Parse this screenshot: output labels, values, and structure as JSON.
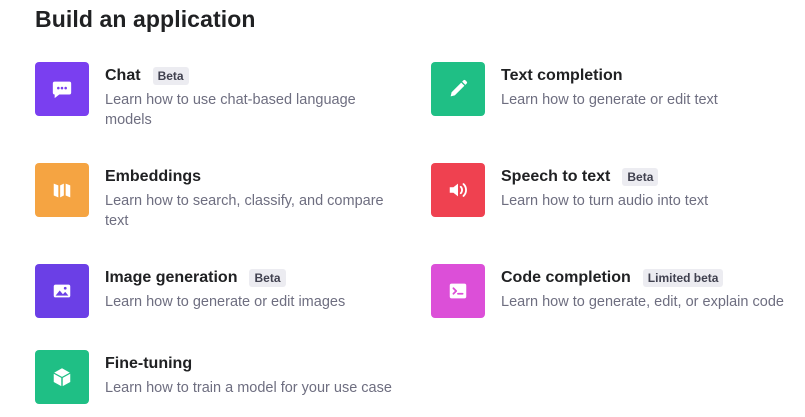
{
  "page": {
    "title": "Build an application"
  },
  "cards": [
    {
      "title": "Chat",
      "badge": "Beta",
      "description": "Learn how to use chat-based language models",
      "icon": "chat-icon",
      "color": "#7a3ff0"
    },
    {
      "title": "Text completion",
      "badge": "",
      "description": "Learn how to generate or edit text",
      "icon": "pencil-icon",
      "color": "#1fbf85"
    },
    {
      "title": "Embeddings",
      "badge": "",
      "description": "Learn how to search, classify, and compare text",
      "icon": "columns-icon",
      "color": "#f5a442"
    },
    {
      "title": "Speech to text",
      "badge": "Beta",
      "description": "Learn how to turn audio into text",
      "icon": "speaker-icon",
      "color": "#ef4150"
    },
    {
      "title": "Image generation",
      "badge": "Beta",
      "description": "Learn how to generate or edit images",
      "icon": "image-icon",
      "color": "#6b3fe6"
    },
    {
      "title": "Code completion",
      "badge": "Limited beta",
      "description": "Learn how to generate, edit, or explain code",
      "icon": "terminal-icon",
      "color": "#dc4fd8"
    },
    {
      "title": "Fine-tuning",
      "badge": "",
      "description": "Learn how to train a model for your use case",
      "icon": "cube-icon",
      "color": "#1fbf85"
    }
  ]
}
